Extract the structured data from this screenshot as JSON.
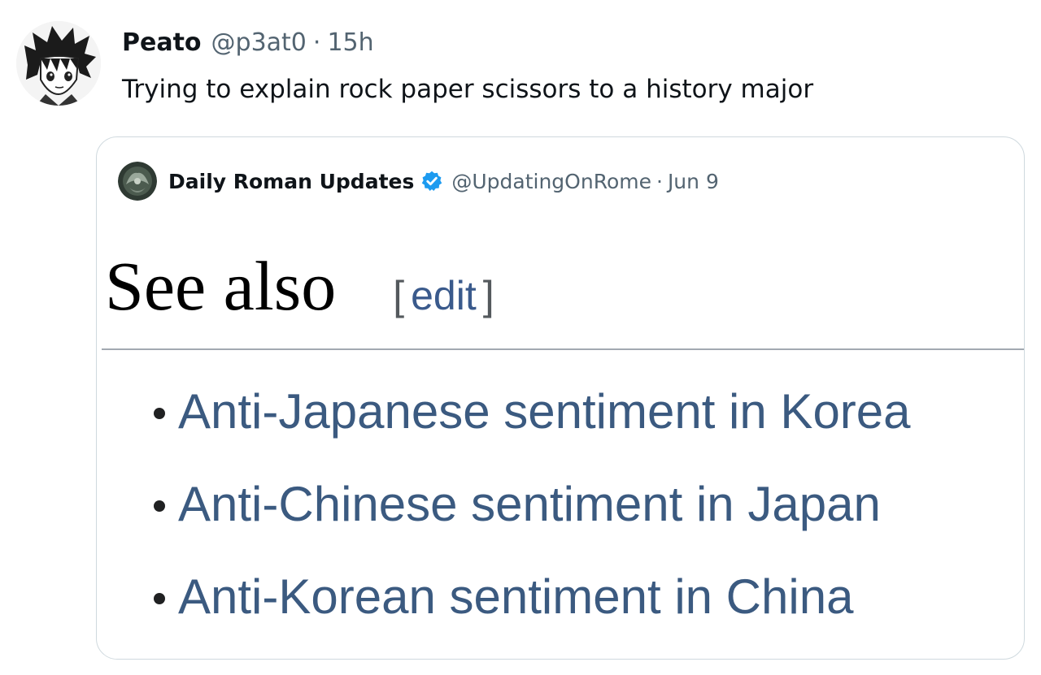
{
  "tweet": {
    "display_name": "Peato",
    "handle": "@p3at0",
    "separator": "·",
    "time": "15h",
    "text": "Trying to explain rock paper scissors to a history major",
    "avatar_icon": "anime-avatar"
  },
  "quoted_tweet": {
    "display_name": "Daily Roman Updates",
    "verified": true,
    "verified_color": "#1d9bf0",
    "handle": "@UpdatingOnRome",
    "separator": "·",
    "date": "Jun 9",
    "avatar_icon": "roman-emblem-avatar",
    "wiki": {
      "heading": "See also",
      "edit_open": "[",
      "edit_label": "edit",
      "edit_close": "]",
      "items": [
        {
          "label": "Anti-Japanese sentiment in Korea"
        },
        {
          "label": "Anti-Chinese sentiment in Japan"
        },
        {
          "label": "Anti-Korean sentiment in China"
        }
      ]
    }
  },
  "colors": {
    "text_primary": "#0f1419",
    "text_secondary": "#536471",
    "card_border": "#cfd9de",
    "wiki_link": "#3b5a80"
  }
}
